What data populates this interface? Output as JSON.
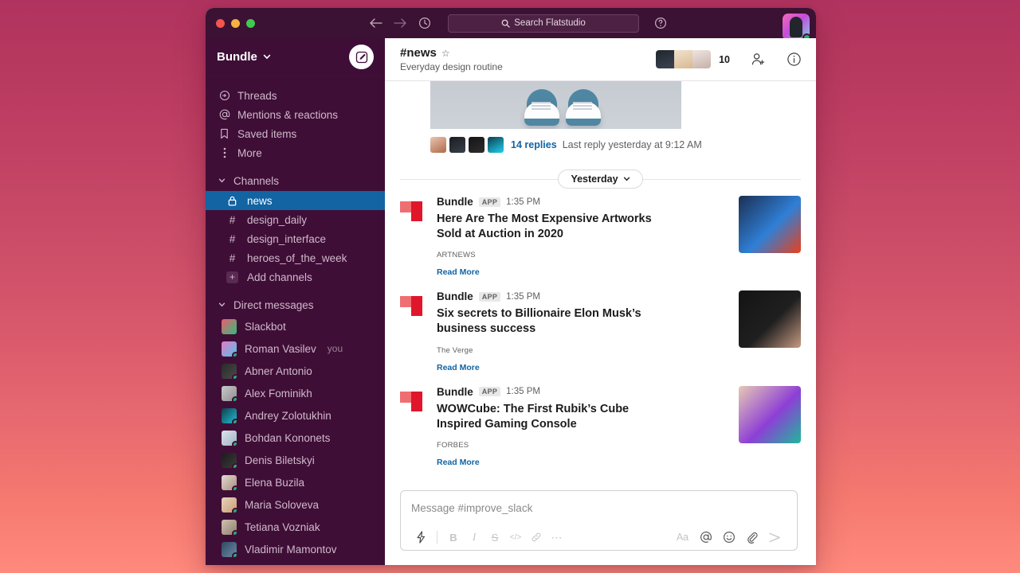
{
  "titlebar": {
    "search_placeholder": "Search Flatstudio",
    "icons": {
      "back": "back-arrow-icon",
      "forward": "forward-arrow-icon",
      "history": "history-clock-icon",
      "search": "search-icon",
      "help": "help-circle-icon",
      "avatar": "user-avatar"
    }
  },
  "sidebar": {
    "workspace": "Bundle",
    "workspace_caret": "⌄",
    "compose_label": "compose-button",
    "nav_items": [
      {
        "label": "Threads",
        "icon": "threads-icon"
      },
      {
        "label": "Mentions & reactions",
        "icon": "at-icon"
      },
      {
        "label": "Saved items",
        "icon": "bookmark-icon"
      },
      {
        "label": "More",
        "icon": "more-vertical-icon"
      }
    ],
    "channels_group": "Channels",
    "channels": [
      {
        "label": "news",
        "icon": "lock-icon",
        "selected": true
      },
      {
        "label": "design_daily",
        "icon": "hash-icon",
        "selected": false
      },
      {
        "label": "design_interface",
        "icon": "hash-icon",
        "selected": false
      },
      {
        "label": "heroes_of_the_week",
        "icon": "hash-icon",
        "selected": false
      }
    ],
    "add_channels": "Add channels",
    "dm_group": "Direct messages",
    "dms": [
      {
        "name": "Slackbot",
        "you": "",
        "presence": false,
        "c1": "#f05a6e",
        "c2": "#2dbf7e"
      },
      {
        "name": "Roman Vasilev",
        "you": "you",
        "presence": true,
        "c1": "#e978c8",
        "c2": "#4fc3e8"
      },
      {
        "name": "Abner Antonio",
        "you": "",
        "presence": true,
        "c1": "#2a2a2a",
        "c2": "#4a4a4a"
      },
      {
        "name": "Alex Fominikh",
        "you": "",
        "presence": true,
        "c1": "#c9c9c9",
        "c2": "#8d8d8d"
      },
      {
        "name": "Andrey Zolotukhin",
        "you": "",
        "presence": true,
        "c1": "#0f3f4a",
        "c2": "#1fbfd6"
      },
      {
        "name": "Bohdan Kononets",
        "you": "",
        "presence": true,
        "c1": "#dce3ea",
        "c2": "#9fb3c4"
      },
      {
        "name": "Denis Biletskyi",
        "you": "",
        "presence": true,
        "c1": "#1b1b1b",
        "c2": "#3c3c3c"
      },
      {
        "name": "Elena Buzila",
        "you": "",
        "presence": true,
        "c1": "#e3d9d2",
        "c2": "#a98f7e"
      },
      {
        "name": "Maria Soloveva",
        "you": "",
        "presence": true,
        "c1": "#e8d3bd",
        "c2": "#c79d72"
      },
      {
        "name": "Tetiana Vozniak",
        "you": "",
        "presence": true,
        "c1": "#cfc2b2",
        "c2": "#8e7f6e"
      },
      {
        "name": "Vladimir Mamontov",
        "you": "",
        "presence": true,
        "c1": "#2f4a63",
        "c2": "#6d8ba6"
      }
    ]
  },
  "channel": {
    "title": "#news",
    "star": "☆",
    "topic": "Everyday design routine",
    "member_count": "10",
    "facepile": [
      {
        "c1": "#21262d",
        "c2": "#3a4450"
      },
      {
        "c1": "#f0e2cf",
        "c2": "#d9b98f"
      },
      {
        "c1": "#efe4e0",
        "c2": "#c6b0a8"
      }
    ],
    "add_member_icon": "add-member-icon",
    "info_icon": "info-circle-icon"
  },
  "thread": {
    "replies": "14 replies",
    "last_reply": "Last reply yesterday at 9:12 AM",
    "avatars": [
      {
        "c1": "#e8c5b0",
        "c2": "#b06a4a"
      },
      {
        "c1": "#1a1d22",
        "c2": "#39404a"
      },
      {
        "c1": "#141414",
        "c2": "#2e2e2e"
      },
      {
        "c1": "#0d3d4d",
        "c2": "#1fd0f0"
      }
    ]
  },
  "divider": {
    "label": "Yesterday",
    "caret": "⌄"
  },
  "messages": [
    {
      "sender": "Bundle",
      "app_tag": "APP",
      "time": "1:35 PM",
      "headline": "Here Are The Most Expensive Artworks Sold at Auction in 2020",
      "source": "ARTNEWS",
      "read_more": "Read More",
      "thumb": "artwork-painting-thumbnail",
      "thumb_c1": "#1c2f52",
      "thumb_c2": "#2f7fd6",
      "thumb_c3": "#e8401c"
    },
    {
      "sender": "Bundle",
      "app_tag": "APP",
      "time": "1:35 PM",
      "headline": "Six secrets to Billionaire Elon Musk’s business success",
      "source": "The Verge",
      "read_more": "Read More",
      "thumb": "elon-musk-portrait-thumbnail",
      "thumb_c1": "#141414",
      "thumb_c2": "#1f1f1f",
      "thumb_c3": "#c79a82"
    },
    {
      "sender": "Bundle",
      "app_tag": "APP",
      "time": "1:35 PM",
      "headline": "WOWCube:  The First Rubik’s Cube Inspired Gaming Console",
      "source": "FORBES",
      "read_more": "Read More",
      "thumb": "wowcube-console-thumbnail",
      "thumb_c1": "#e6c9b4",
      "thumb_c2": "#8d3fd6",
      "thumb_c3": "#1fb89a"
    }
  ],
  "composer": {
    "placeholder": "Message #improve_slack",
    "left_tools": [
      {
        "name": "lightning-shortcut-icon",
        "glyph": "⚡"
      },
      {
        "name": "bold-icon",
        "glyph": "B"
      },
      {
        "name": "italic-icon",
        "glyph": "I"
      },
      {
        "name": "strikethrough-icon",
        "glyph": "S"
      },
      {
        "name": "code-icon",
        "glyph": "</>"
      },
      {
        "name": "link-icon",
        "glyph": "⌁"
      },
      {
        "name": "more-formatting-icon",
        "glyph": "⋯"
      }
    ],
    "right_tools": [
      {
        "name": "formatting-aa-icon",
        "glyph": "Aa"
      },
      {
        "name": "mention-at-icon",
        "glyph": "@"
      },
      {
        "name": "emoji-icon",
        "glyph": "☺"
      },
      {
        "name": "attachment-icon",
        "glyph": "📎"
      },
      {
        "name": "send-icon",
        "glyph": "➤"
      }
    ]
  },
  "colors": {
    "sidebar_bg": "#3f0e37",
    "titlebar_bg": "#3b1233",
    "selected_channel": "#1264a3",
    "link_blue": "#1264a3",
    "bundle_red": "#e0162b"
  }
}
